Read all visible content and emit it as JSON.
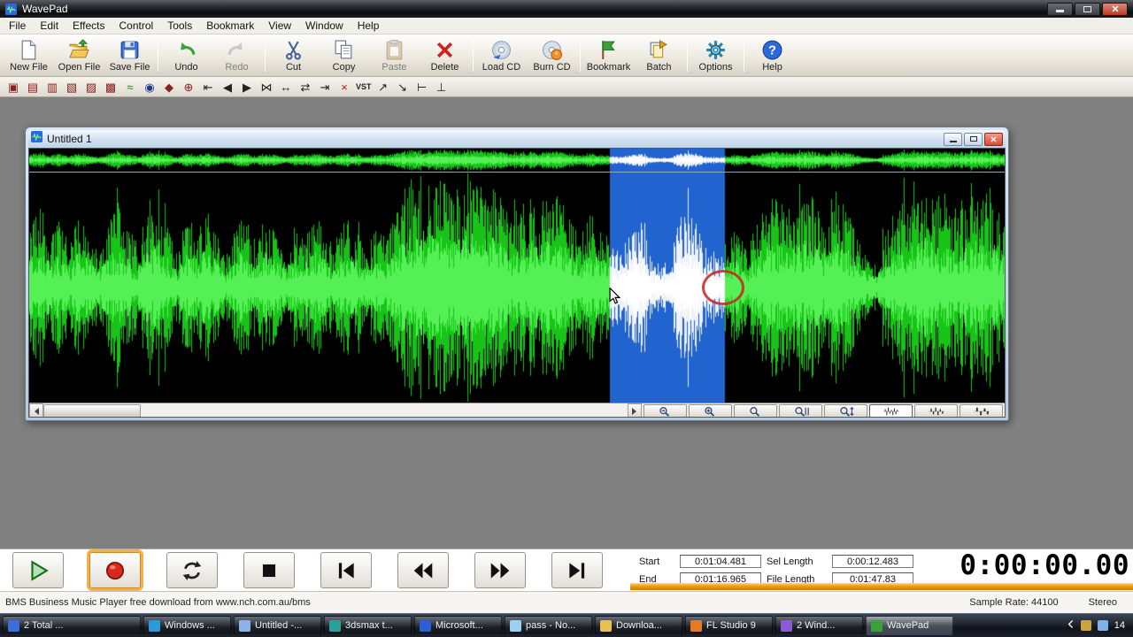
{
  "window": {
    "title": "WavePad"
  },
  "menu": {
    "items": [
      "File",
      "Edit",
      "Effects",
      "Control",
      "Tools",
      "Bookmark",
      "View",
      "Window",
      "Help"
    ]
  },
  "toolbar": {
    "groups": [
      [
        {
          "name": "new-file",
          "label": "New File"
        },
        {
          "name": "open-file",
          "label": "Open File"
        },
        {
          "name": "save-file",
          "label": "Save File"
        }
      ],
      [
        {
          "name": "undo",
          "label": "Undo"
        },
        {
          "name": "redo",
          "label": "Redo",
          "disabled": true
        }
      ],
      [
        {
          "name": "cut",
          "label": "Cut"
        },
        {
          "name": "copy",
          "label": "Copy"
        },
        {
          "name": "paste",
          "label": "Paste",
          "disabled": true
        },
        {
          "name": "delete",
          "label": "Delete"
        }
      ],
      [
        {
          "name": "load-cd",
          "label": "Load CD"
        },
        {
          "name": "burn-cd",
          "label": "Burn CD"
        }
      ],
      [
        {
          "name": "bookmark",
          "label": "Bookmark"
        },
        {
          "name": "batch",
          "label": "Batch"
        }
      ],
      [
        {
          "name": "options",
          "label": "Options"
        }
      ],
      [
        {
          "name": "help",
          "label": "Help"
        }
      ]
    ]
  },
  "toolbar2": {
    "icons": [
      {
        "name": "copy-to-new",
        "glyph": "▣",
        "color": "#8a2020"
      },
      {
        "name": "paste-insert",
        "glyph": "▤",
        "color": "#8a2020"
      },
      {
        "name": "paste-mix",
        "glyph": "▥",
        "color": "#8a2020"
      },
      {
        "name": "trim",
        "glyph": "▧",
        "color": "#8a2020"
      },
      {
        "name": "crop",
        "glyph": "▨",
        "color": "#8a2020"
      },
      {
        "name": "silence",
        "glyph": "▩",
        "color": "#8a2020"
      },
      {
        "name": "envelope",
        "glyph": "≈",
        "color": "#1a7a1a"
      },
      {
        "name": "scrub",
        "glyph": "◉",
        "color": "#203a8a"
      },
      {
        "name": "marker",
        "glyph": "◆",
        "color": "#8a2020"
      },
      {
        "name": "join",
        "glyph": "⊕",
        "color": "#8a2020"
      },
      {
        "name": "go-start",
        "glyph": "⇤",
        "color": "#222222"
      },
      {
        "name": "prev",
        "glyph": "◀",
        "color": "#222222"
      },
      {
        "name": "play-small",
        "glyph": "▶",
        "color": "#222222"
      },
      {
        "name": "splice",
        "glyph": "⋈",
        "color": "#222222"
      },
      {
        "name": "loop-small",
        "glyph": "↔",
        "color": "#222222"
      },
      {
        "name": "swap",
        "glyph": "⇄",
        "color": "#222222"
      },
      {
        "name": "go-end",
        "glyph": "⇥",
        "color": "#222222"
      },
      {
        "name": "delete-small",
        "glyph": "×",
        "color": "#b02020"
      },
      {
        "name": "vst",
        "glyph": "VST",
        "color": "#222222",
        "text": true
      },
      {
        "name": "fade-in",
        "glyph": "↗",
        "color": "#222222"
      },
      {
        "name": "fade-out",
        "glyph": "↘",
        "color": "#222222"
      },
      {
        "name": "level",
        "glyph": "⊢",
        "color": "#222222"
      },
      {
        "name": "anchor",
        "glyph": "⊥",
        "color": "#222222"
      }
    ]
  },
  "doc_window": {
    "title": "Untitled 1",
    "selection": {
      "start": 0.596,
      "end": 0.713
    },
    "waveform": {
      "color": "#17c417",
      "selection_color": "#ffffff",
      "background": "#000000",
      "selection_background": "#2163cf",
      "envelope": [
        0.55,
        0.72,
        0.45,
        0.62,
        0.38,
        0.66,
        0.5,
        0.3,
        0.6,
        0.76,
        0.52,
        0.4,
        0.66,
        0.8,
        0.56,
        0.34,
        0.62,
        0.5,
        0.72,
        0.46,
        0.3,
        0.56,
        0.66,
        0.4,
        0.62,
        0.5,
        0.34,
        0.56,
        0.46,
        0.66,
        0.5,
        0.4,
        0.62,
        0.56,
        0.34,
        0.5,
        0.46,
        0.6,
        0.85,
        1.0,
        1.0,
        0.95,
        1.0,
        0.9,
        1.0,
        0.95,
        0.85,
        0.9,
        0.8,
        0.6,
        0.72,
        0.85,
        0.76,
        0.9,
        0.8,
        0.6,
        0.5,
        0.66,
        0.56,
        0.4,
        0.32,
        0.5,
        0.66,
        0.3,
        0.2,
        0.26,
        0.6,
        0.72,
        0.5,
        0.3,
        0.26,
        0.42,
        0.5,
        0.36,
        0.62,
        0.76,
        0.85,
        0.7,
        0.8,
        0.9,
        0.76,
        0.6,
        0.8,
        0.7,
        0.5,
        0.26,
        0.2,
        0.5,
        0.7,
        0.85,
        0.76,
        0.9,
        0.8,
        0.85,
        0.7,
        0.8,
        0.9,
        0.85,
        0.76,
        0.6
      ]
    },
    "zoom_buttons": [
      {
        "name": "zoom-out"
      },
      {
        "name": "zoom-in"
      },
      {
        "name": "zoom-normal"
      },
      {
        "name": "zoom-selection"
      },
      {
        "name": "zoom-vertical"
      },
      {
        "name": "view-wave-small",
        "pressed": true
      },
      {
        "name": "view-wave-medium"
      },
      {
        "name": "view-wave-large"
      }
    ]
  },
  "transport": {
    "buttons": [
      {
        "name": "play"
      },
      {
        "name": "record",
        "focused": true
      },
      {
        "name": "loop"
      },
      {
        "name": "stop"
      },
      {
        "name": "skip-start"
      },
      {
        "name": "rewind"
      },
      {
        "name": "fast-forward"
      },
      {
        "name": "skip-end"
      }
    ]
  },
  "fields": {
    "start": {
      "label": "Start",
      "value": "0:01:04.481"
    },
    "sel": {
      "label": "Sel Length",
      "value": "0:00:12.483"
    },
    "end": {
      "label": "End",
      "value": "0:01:16.965"
    },
    "file": {
      "label": "File Length",
      "value": "0:01:47.83"
    }
  },
  "time_display": {
    "value": "0:00:00.00"
  },
  "status_bar": {
    "message": "BMS Business Music Player free download from www.nch.com.au/bms",
    "sample_rate": "Sample Rate: 44100",
    "channels": "Stereo"
  },
  "taskbar": {
    "items": [
      {
        "label": "2 Total ...",
        "color": "#3a6fd8"
      },
      {
        "label": "Windows ...",
        "color": "#2a9ad8"
      },
      {
        "label": "Untitled -...",
        "color": "#8ab4e8"
      },
      {
        "label": "3dsmax t...",
        "color": "#2aa198"
      },
      {
        "label": "Microsoft...",
        "color": "#2a5fd8"
      },
      {
        "label": "pass - No...",
        "color": "#9ad0f0"
      },
      {
        "label": "Downloa...",
        "color": "#e8c14a"
      },
      {
        "label": "FL Studio 9",
        "color": "#e87a1d"
      },
      {
        "label": "2 Wind...",
        "color": "#8a5ad8"
      },
      {
        "label": "WavePad",
        "color": "#3aa13a",
        "active": true
      }
    ],
    "tray_icons": [
      {
        "name": "tray-settings-icon",
        "color": "#caa53a"
      },
      {
        "name": "tray-network-icon",
        "color": "#7fb2e8"
      }
    ],
    "clock": "14"
  }
}
